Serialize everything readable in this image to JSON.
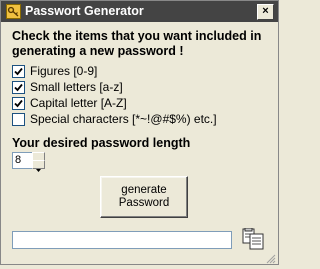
{
  "window": {
    "title": "Passwort Generator",
    "close_glyph": "×"
  },
  "instructions": "Check the items that you want included in generating a new password !",
  "options": [
    {
      "label": "Figures [0-9]",
      "checked": true
    },
    {
      "label": "Small letters [a-z]",
      "checked": true
    },
    {
      "label": "Capital letter [A-Z]",
      "checked": true
    },
    {
      "label": "Special characters [*~!@#$%) etc.]",
      "checked": false
    }
  ],
  "length": {
    "label": "Your desired password length",
    "value": "8"
  },
  "generate_button": {
    "label": "generate Password"
  },
  "output": {
    "value": ""
  },
  "icons": {
    "app": "key-icon",
    "copy": "copy-icon"
  },
  "colors": {
    "titlebar": "#444444",
    "dialog_bg": "#ece9d8"
  }
}
